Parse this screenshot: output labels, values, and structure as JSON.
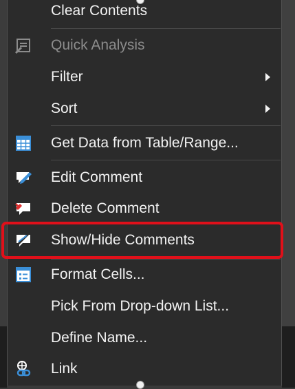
{
  "menu": {
    "items": [
      {
        "label": "Clear Contents"
      },
      {
        "label": "Quick Analysis"
      },
      {
        "label": "Filter"
      },
      {
        "label": "Sort"
      },
      {
        "label": "Get Data from Table/Range..."
      },
      {
        "label": "Edit Comment"
      },
      {
        "label": "Delete Comment"
      },
      {
        "label": "Show/Hide Comments"
      },
      {
        "label": "Format Cells..."
      },
      {
        "label": "Pick From Drop-down List..."
      },
      {
        "label": "Define Name..."
      },
      {
        "label": "Link"
      }
    ]
  },
  "colors": {
    "menu_background": "#2b2b2b",
    "text": "#f2f2f2",
    "disabled_text": "#8c8c8c",
    "highlight_border": "#e0101a",
    "icon_blue": "#3b8fd8"
  },
  "icons": [
    "quick-analysis-icon",
    "table-icon",
    "edit-comment-icon",
    "delete-comment-icon",
    "show-hide-comments-icon",
    "format-cells-icon",
    "link-icon"
  ]
}
